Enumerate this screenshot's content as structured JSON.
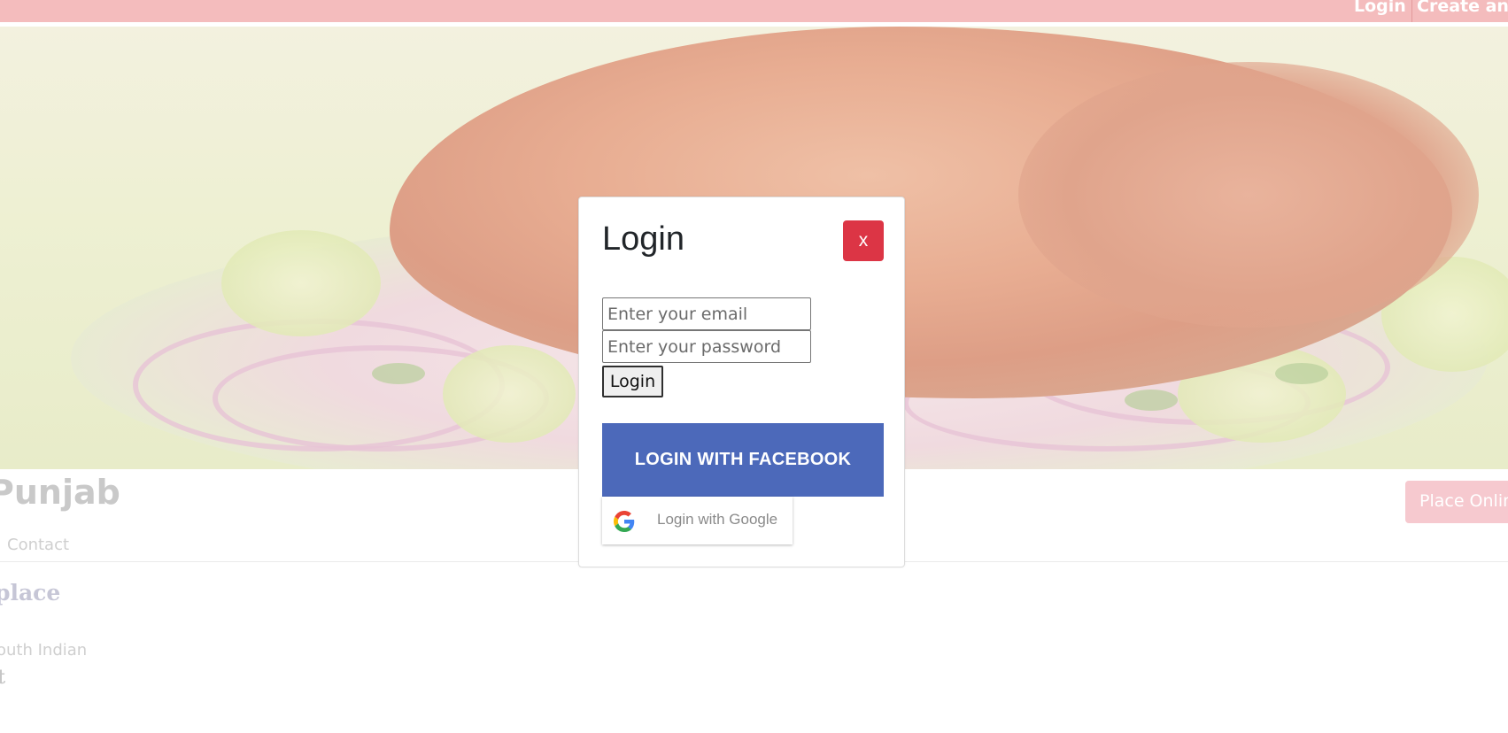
{
  "topnav": {
    "login_label": "Login",
    "create_account_label": "Create an a"
  },
  "restaurant": {
    "name": "Punjab",
    "place_order_label": "Place Onlin",
    "tab_contact": "Contact",
    "overview_title": "place",
    "cuisine": "outh Indian",
    "cost_label": "t"
  },
  "login_modal": {
    "title": "Login",
    "close_label": "x",
    "email_placeholder": "Enter your email",
    "password_placeholder": "Enter your password",
    "submit_label": "Login",
    "facebook_label": "LOGIN WITH FACEBOOK",
    "google_label": "Login with Google"
  },
  "colors": {
    "topbar": "#f4bcbd",
    "close_button": "#dc3545",
    "facebook": "#4c69ba"
  }
}
